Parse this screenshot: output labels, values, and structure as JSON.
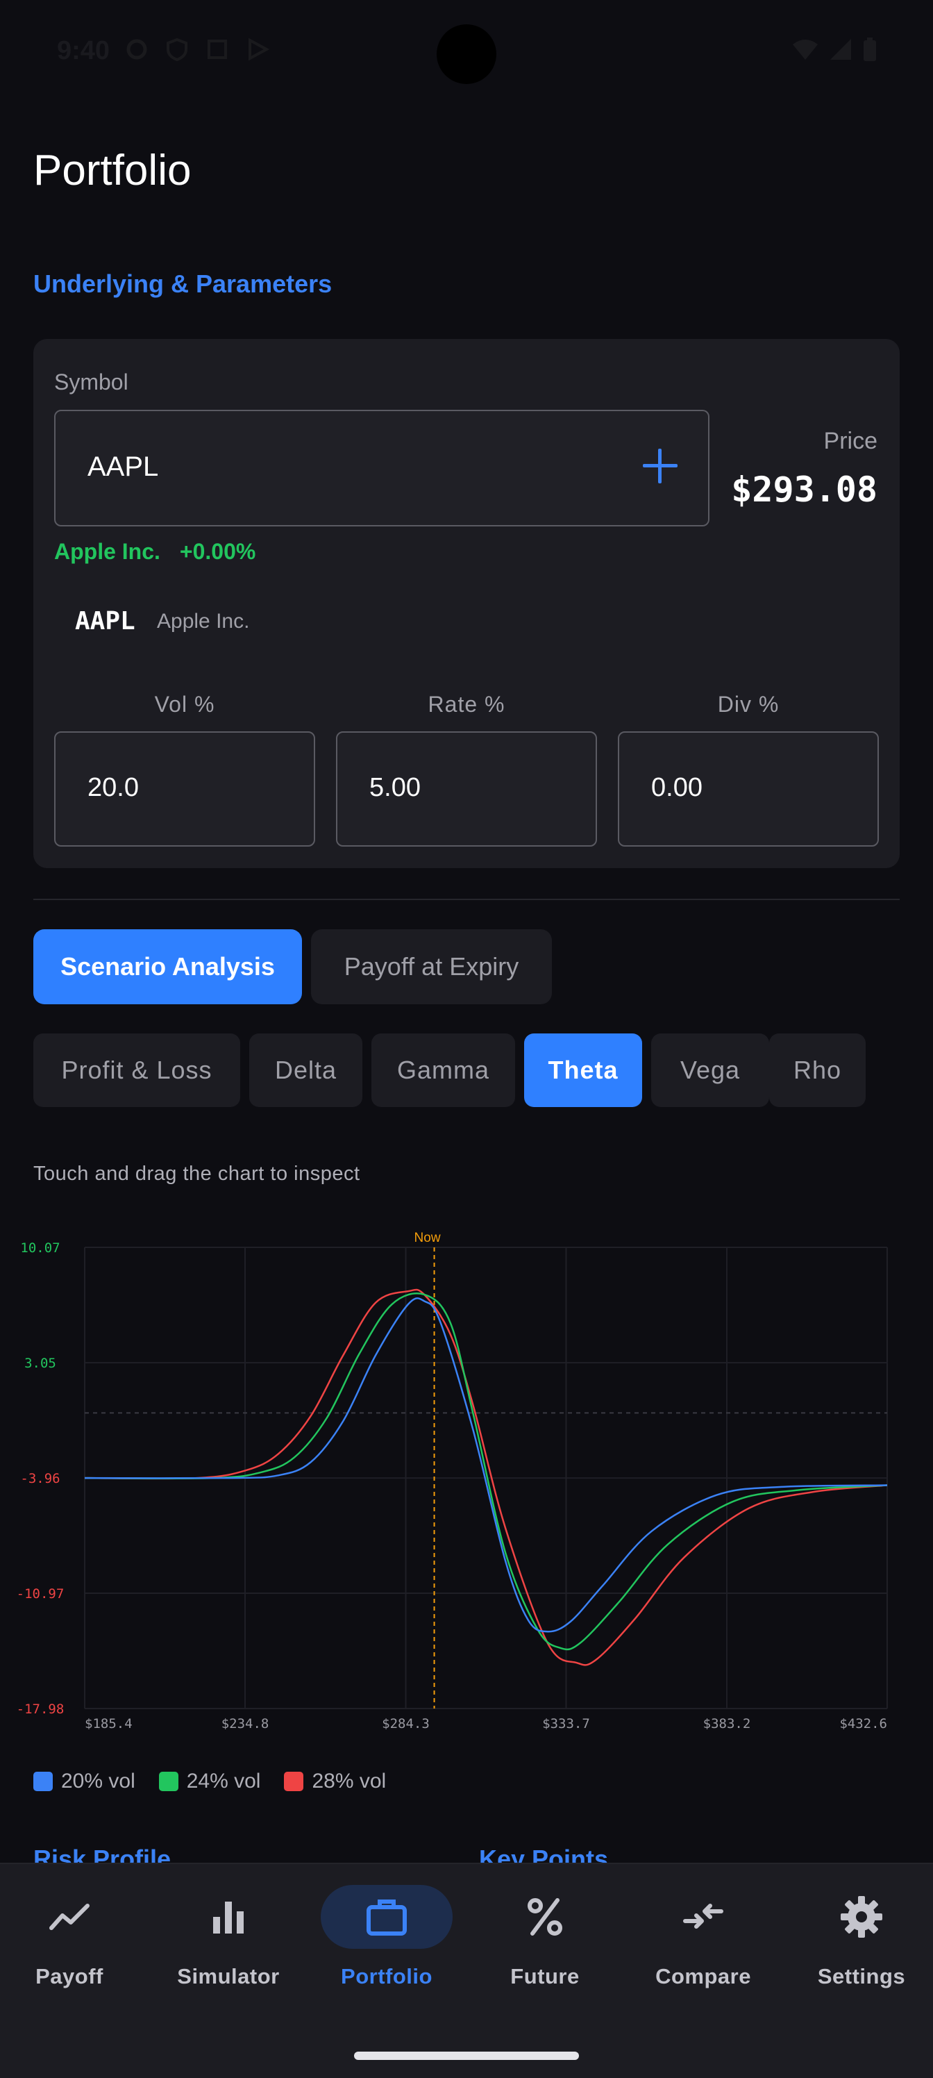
{
  "status_bar": {
    "time": "9:40"
  },
  "page": {
    "title": "Portfolio"
  },
  "params_section": {
    "title": "Underlying & Parameters",
    "symbol_label": "Symbol",
    "symbol_value": "AAPL",
    "price_label": "Price",
    "price_value": "$293.08",
    "company_name": "Apple Inc.",
    "change_pct": "+0.00%",
    "suggestion_ticker": "AAPL",
    "suggestion_name": "Apple Inc.",
    "vol_label": "Vol %",
    "vol_value": "20.0",
    "rate_label": "Rate %",
    "rate_value": "5.00",
    "div_label": "Div %",
    "div_value": "0.00"
  },
  "mode_tabs": [
    {
      "label": "Scenario Analysis",
      "active": true
    },
    {
      "label": "Payoff at Expiry",
      "active": false
    }
  ],
  "greek_tabs": [
    {
      "label": "Profit & Loss",
      "active": false
    },
    {
      "label": "Delta",
      "active": false
    },
    {
      "label": "Gamma",
      "active": false
    },
    {
      "label": "Theta",
      "active": true
    },
    {
      "label": "Vega",
      "active": false
    },
    {
      "label": "Rho",
      "active": false
    }
  ],
  "chart": {
    "hint": "Touch and drag the chart to inspect"
  },
  "chart_data": {
    "type": "line",
    "title": "",
    "xlabel": "",
    "ylabel": "",
    "x_tick_labels": [
      "$185.4",
      "$234.8",
      "$284.3",
      "$333.7",
      "$383.2",
      "$432.6"
    ],
    "x_ticks": [
      185.4,
      234.8,
      284.3,
      333.7,
      383.2,
      432.6
    ],
    "y_tick_labels": [
      "10.07",
      "3.05",
      "-3.96",
      "-10.97",
      "-17.98"
    ],
    "y_ticks": [
      10.07,
      3.05,
      -3.96,
      -10.97,
      -17.98
    ],
    "xlim": [
      185.4,
      432.6
    ],
    "ylim": [
      -17.98,
      10.07
    ],
    "zero_line": 0,
    "now_marker": {
      "label": "Now",
      "x": 293.08
    },
    "grid": true,
    "legend_position": "bottom-left",
    "series": [
      {
        "name": "20% vol",
        "color": "#3b82f6",
        "x": [
          185.4,
          230,
          245,
          255,
          265,
          275,
          285,
          290,
          295,
          305,
          315,
          322,
          328,
          335,
          345,
          360,
          380,
          400,
          432.6
        ],
        "y": [
          -3.96,
          -3.96,
          -3.8,
          -3.0,
          -0.5,
          3.5,
          6.6,
          6.8,
          5.5,
          -1.0,
          -9.0,
          -12.6,
          -13.3,
          -12.7,
          -10.5,
          -7.2,
          -5.0,
          -4.5,
          -4.4
        ]
      },
      {
        "name": "24% vol",
        "color": "#22c55e",
        "x": [
          185.4,
          225,
          240,
          250,
          260,
          270,
          280,
          290,
          298,
          305,
          315,
          325,
          332,
          338,
          350,
          365,
          385,
          405,
          432.6
        ],
        "y": [
          -3.96,
          -3.96,
          -3.6,
          -2.7,
          -0.3,
          3.6,
          6.6,
          7.2,
          5.5,
          0.0,
          -8.5,
          -13.2,
          -14.3,
          -14.0,
          -11.5,
          -8.0,
          -5.4,
          -4.7,
          -4.4
        ]
      },
      {
        "name": "28% vol",
        "color": "#ef4444",
        "x": [
          185.4,
          220,
          235,
          245,
          255,
          265,
          275,
          285,
          290,
          298,
          305,
          315,
          328,
          337,
          343,
          355,
          370,
          390,
          410,
          432.6
        ],
        "y": [
          -3.96,
          -3.96,
          -3.5,
          -2.5,
          -0.2,
          3.5,
          6.7,
          7.4,
          7.2,
          4.8,
          0.5,
          -7.0,
          -14.0,
          -15.2,
          -15.0,
          -12.5,
          -8.8,
          -5.8,
          -4.8,
          -4.4
        ]
      }
    ]
  },
  "peek": {
    "left_title": "Risk Profile",
    "right_title": "Key Points"
  },
  "bottom_nav": [
    {
      "label": "Payoff",
      "icon": "trend-line-icon",
      "active": false
    },
    {
      "label": "Simulator",
      "icon": "bar-chart-icon",
      "active": false
    },
    {
      "label": "Portfolio",
      "icon": "briefcase-icon",
      "active": true
    },
    {
      "label": "Future",
      "icon": "percent-icon",
      "active": false
    },
    {
      "label": "Compare",
      "icon": "compare-arrows-icon",
      "active": false
    },
    {
      "label": "Settings",
      "icon": "gear-icon",
      "active": false
    }
  ],
  "colors": {
    "accent": "#2f80ff",
    "positive": "#22c55e",
    "axis_positive": "#22c55e",
    "axis_negative": "#ef4444",
    "now_marker": "#f59e0b"
  }
}
